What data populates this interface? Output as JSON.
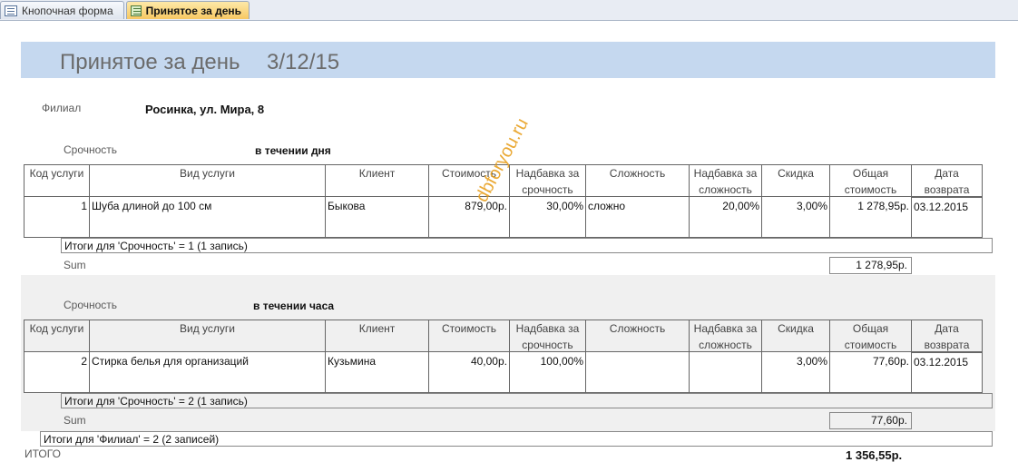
{
  "tabs": [
    {
      "label": "Кнопочная форма",
      "icon": "form-icon"
    },
    {
      "label": "Принятое за день",
      "icon": "report-icon"
    }
  ],
  "report": {
    "title": "Принятое за день",
    "date": "3/12/15",
    "filial_label": "Филиал",
    "filial_value": "Росинка, ул. Мира, 8",
    "columns": [
      "Код услуги",
      "Вид услуги",
      "Клиент",
      "Стоимость",
      "Надбавка за срочность",
      "Сложность",
      "Надбавка за сложность",
      "Скидка",
      "Общая стоимость",
      "Дата возврата"
    ],
    "groups": [
      {
        "urgency_label": "Срочность",
        "urgency_value": "в течении дня",
        "rows": [
          {
            "code": "1",
            "service": "Шуба длиной  до 100 см",
            "client": "Быкова",
            "cost": "879,00р.",
            "urgent_markup": "30,00%",
            "complexity": "сложно",
            "complexity_markup": "20,00%",
            "discount": "3,00%",
            "total": "1 278,95р.",
            "return_date": "03.12.2015"
          }
        ],
        "totals_text": "Итоги для 'Срочность' = 1 (1 запись)",
        "sum_label": "Sum",
        "sum_value": "1 278,95р."
      },
      {
        "urgency_label": "Срочность",
        "urgency_value": "в течении часа",
        "rows": [
          {
            "code": "2",
            "service": "Стирка  белья  для  организаций",
            "client": "Кузьмина",
            "cost": "40,00р.",
            "urgent_markup": "100,00%",
            "complexity": "",
            "complexity_markup": "",
            "discount": "3,00%",
            "total": "77,60р.",
            "return_date": "03.12.2015"
          }
        ],
        "totals_text": "Итоги для 'Срочность' = 2 (1 запись)",
        "sum_label": "Sum",
        "sum_value": "77,60р."
      }
    ],
    "filial_totals_text": "Итоги для 'Филиал' = 2 (2 записей)",
    "grand_label": "ИТОГО",
    "grand_value": "1 356,55р.",
    "watermark": "dbforyou.ru"
  }
}
